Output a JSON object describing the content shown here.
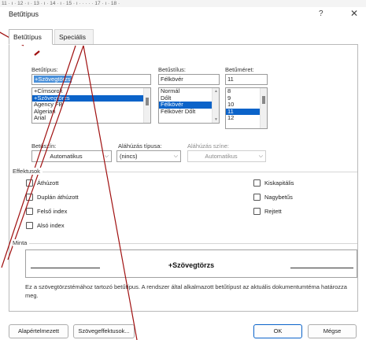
{
  "ruler": {
    "text": "11 · ı · 12 · ı · 13 · ı · 14 · ı · 15 · ı ·  ·  ·  ·  · 17 · ı · 18 ·"
  },
  "window": {
    "title": "Betűtípus",
    "help": "?",
    "close": "✕"
  },
  "tabs": [
    {
      "label": "Betűtípus"
    },
    {
      "label": "Speciális"
    }
  ],
  "font": {
    "label": "Betűtípus:",
    "value": "+Szövegtörzs",
    "list": [
      "+Címsorok",
      "+Szövegtörzs",
      "Agency FB",
      "Algerian",
      "Arial"
    ],
    "selected_index": 1
  },
  "style": {
    "label": "Betűstílus:",
    "value": "Félkövér",
    "list": [
      "Normál",
      "Dőlt",
      "Félkövér",
      "Félkövér Dőlt"
    ],
    "selected_index": 2
  },
  "size": {
    "label": "Betűméret:",
    "value": "11",
    "list": [
      "8",
      "9",
      "10",
      "11",
      "12"
    ],
    "selected_index": 3
  },
  "color": {
    "label": "Betűszín:",
    "value": "Automatikus"
  },
  "underline": {
    "label": "Aláhúzás típusa:",
    "value": "(nincs)"
  },
  "underline_color": {
    "label": "Aláhúzás színe:",
    "value": "Automatikus"
  },
  "effects": {
    "title": "Effektusok",
    "left": [
      "Áthúzott",
      "Duplán áthúzott",
      "Felső index",
      "Alsó index"
    ],
    "right": [
      "Kiskapitális",
      "Nagybetűs",
      "Rejtett"
    ]
  },
  "preview": {
    "title": "Minta",
    "text": "+Szövegtörzs",
    "description": "Ez a szövegtörzstémához tartozó betűtípus. A rendszer által alkalmazott betűtípust az aktuális dokumentumtéma határozza meg."
  },
  "buttons": {
    "default": "Alapértelmezett",
    "text_effects": "Szövegeffektusok...",
    "ok": "OK",
    "cancel": "Mégse"
  },
  "annotation_color": "#a01010"
}
